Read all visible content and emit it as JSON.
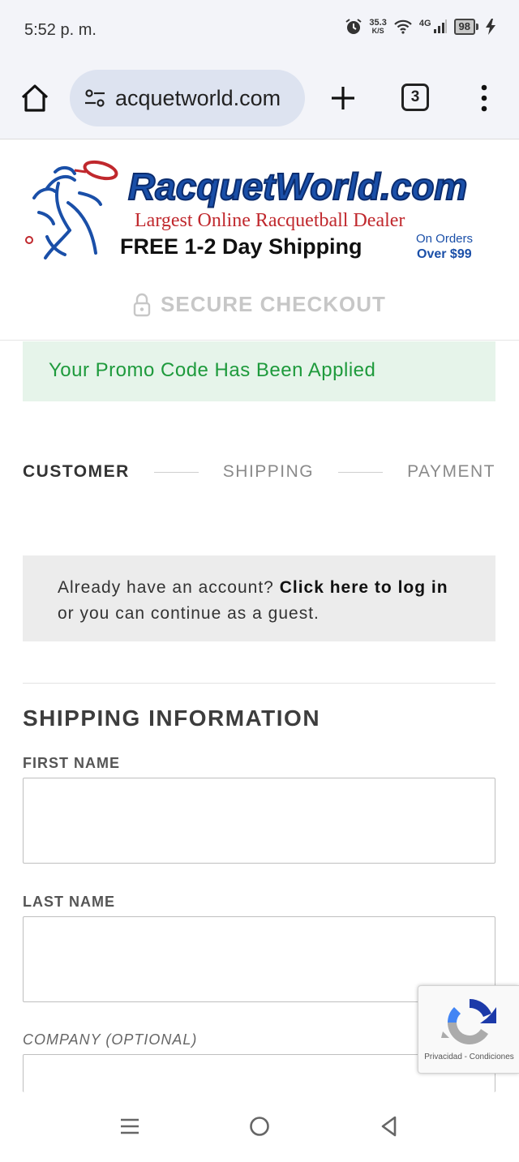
{
  "status_bar": {
    "time": "5:52 p. m.",
    "net_speed_value": "35.3",
    "net_speed_unit": "K/S",
    "network_type": "4G",
    "battery_level": "98",
    "icons": [
      "alarm-icon",
      "wifi-icon",
      "signal-icon",
      "battery-icon",
      "charging-icon"
    ]
  },
  "browser": {
    "url": "acquetworld.com",
    "tab_count": "3",
    "icons": [
      "home-icon",
      "site-settings-icon",
      "new-tab-icon",
      "tabs-icon",
      "more-menu-icon"
    ]
  },
  "header": {
    "logo_text": "RacquetWorld.com",
    "tagline": "Largest Online Racquetball Dealer",
    "shipping": "FREE 1-2 Day Shipping",
    "shipping_note_line1": "On Orders",
    "shipping_note_line2": "Over $99",
    "secure_checkout": "SECURE CHECKOUT"
  },
  "promo": {
    "message": "Your Promo Code Has Been Applied"
  },
  "steps": [
    {
      "label": "CUSTOMER",
      "state": "active"
    },
    {
      "label": "SHIPPING",
      "state": "inactive"
    },
    {
      "label": "PAYMENT",
      "state": "inactive"
    }
  ],
  "login_notice": {
    "prefix": "Already have an account?",
    "link": "Click here to log in",
    "suffix": "or you can continue as a guest."
  },
  "shipping_info": {
    "title": "SHIPPING INFORMATION",
    "first_name_label": "FIRST NAME",
    "first_name_value": "",
    "last_name_label": "LAST NAME",
    "last_name_value": "",
    "company_label": "COMPANY (OPTIONAL)",
    "company_value": ""
  },
  "recaptcha": {
    "terms": "Privacidad - Condiciones"
  },
  "nav_bar": {
    "icons": [
      "recents-icon",
      "home-circle-icon",
      "back-icon"
    ]
  },
  "colors": {
    "promo_bg": "#e6f4ea",
    "promo_text": "#1e9a3c",
    "logo_blue": "#1a4fa8",
    "logo_red": "#c0282d",
    "url_pill": "#dde3f0"
  }
}
